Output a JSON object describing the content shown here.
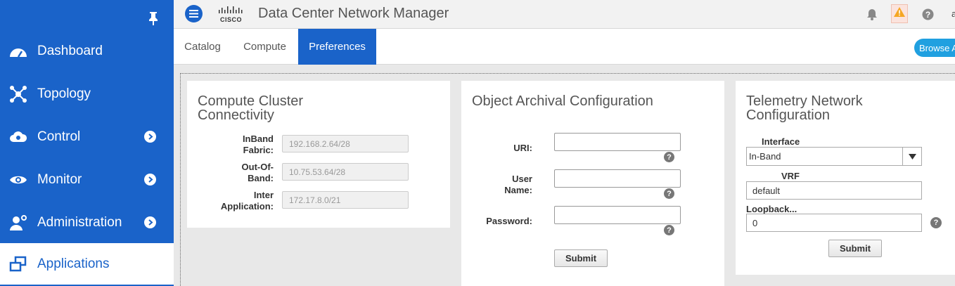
{
  "app": {
    "title": "Data Center Network Manager",
    "user_initial": "a"
  },
  "sidebar": {
    "items": [
      {
        "label": "Dashboard",
        "icon": "dashboard-icon"
      },
      {
        "label": "Topology",
        "icon": "topology-icon"
      },
      {
        "label": "Control",
        "icon": "control-icon"
      },
      {
        "label": "Monitor",
        "icon": "eye-icon"
      },
      {
        "label": "Administration",
        "icon": "admin-user-icon"
      },
      {
        "label": "Applications",
        "icon": "applications-icon"
      }
    ],
    "active": "Applications"
  },
  "tabs": [
    {
      "label": "Catalog"
    },
    {
      "label": "Compute"
    },
    {
      "label": "Preferences"
    }
  ],
  "active_tab": "Preferences",
  "browse_button": "Browse A",
  "compute_panel": {
    "title_line1": "Compute Cluster",
    "title_line2": "Connectivity",
    "fields": [
      {
        "label_line1": "InBand",
        "label_line2": "Fabric:",
        "value": "192.168.2.64/28"
      },
      {
        "label_line1": "Out-Of-",
        "label_line2": "Band:",
        "value": "10.75.53.64/28"
      },
      {
        "label_line1": "Inter",
        "label_line2": "Application:",
        "value": "172.17.8.0/21"
      }
    ]
  },
  "archival_panel": {
    "title": "Object Archival Configuration",
    "uri_label": "URI:",
    "user_label_line1": "User",
    "user_label_line2": "Name:",
    "password_label": "Password:",
    "uri_value": "",
    "user_value": "",
    "password_value": "",
    "submit": "Submit"
  },
  "telemetry_panel": {
    "title_line1": "Telemetry Network",
    "title_line2": "Configuration",
    "interface_label": "Interface",
    "interface_value": "In-Band",
    "vrf_label": "VRF",
    "vrf_value": "default",
    "loopback_label": "Loopback...",
    "loopback_value": "0",
    "submit": "Submit"
  },
  "colors": {
    "primary": "#1a63c9",
    "browse": "#20a0e0",
    "alert": "#f5a623"
  }
}
